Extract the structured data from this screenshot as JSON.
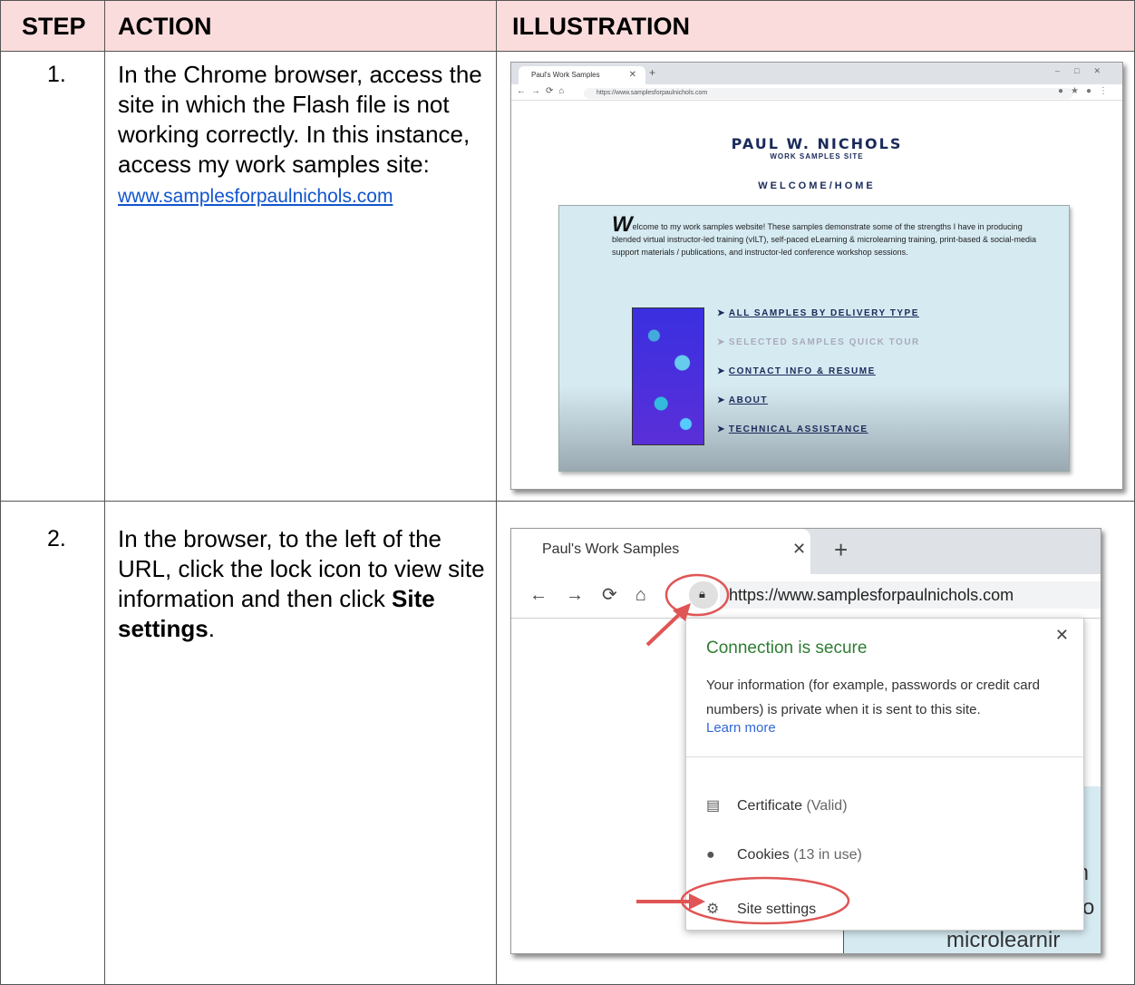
{
  "headers": {
    "step": "STEP",
    "action": "ACTION",
    "illustration": "ILLUSTRATION"
  },
  "rows": [
    {
      "step": "1.",
      "action_text": "In the Chrome browser, access the site in which the Flash file is not working correctly. In this instance, access my work samples site:",
      "link": "www.samplesforpaulnichols.com",
      "shot": {
        "tab_title": "Paul's Work Samples",
        "url": "https://www.samplesforpaulnichols.com",
        "site_title": "PAUL W. NICHOLS",
        "site_subtitle": "WORK SAMPLES SITE",
        "welcome": "WELCOME/HOME",
        "intro_initial": "W",
        "intro": "elcome to my work samples website! These samples demonstrate some of the strengths I have in producing blended virtual instructor-led training (vILT), self-paced eLearning & microlearning training, print-based & social-media support materials / publications, and instructor-led conference workshop sessions.",
        "links": [
          "ALL SAMPLES BY DELIVERY TYPE",
          "SELECTED SAMPLES QUICK TOUR",
          "CONTACT INFO & RESUME",
          "ABOUT",
          "TECHNICAL ASSISTANCE"
        ]
      }
    },
    {
      "step": "2.",
      "action_text_1": "In the browser, to the left of the URL, click the lock icon to view site information and then click ",
      "action_bold": "Site settings",
      "action_text_2": ".",
      "shot": {
        "tab_title": "Paul's Work Samples",
        "url": "https://www.samplesforpaulnichols.com",
        "secure": "Connection is secure",
        "info": "Your information (for example, passwords or credit card numbers) is private when it is sent to this site.",
        "learn_more": "Learn more",
        "certificate": "Certificate",
        "certificate_status": "(Valid)",
        "cookies": "Cookies",
        "cookies_status": "(13 in use)",
        "site_settings": "Site settings",
        "bg_fragments": [
          "m",
          "ro",
          "microlearnir"
        ]
      }
    }
  ],
  "colors": {
    "header_bg": "#fadcdc",
    "link": "#1155cc",
    "secure_green": "#2e7d32",
    "annotation_red": "#e05555"
  }
}
